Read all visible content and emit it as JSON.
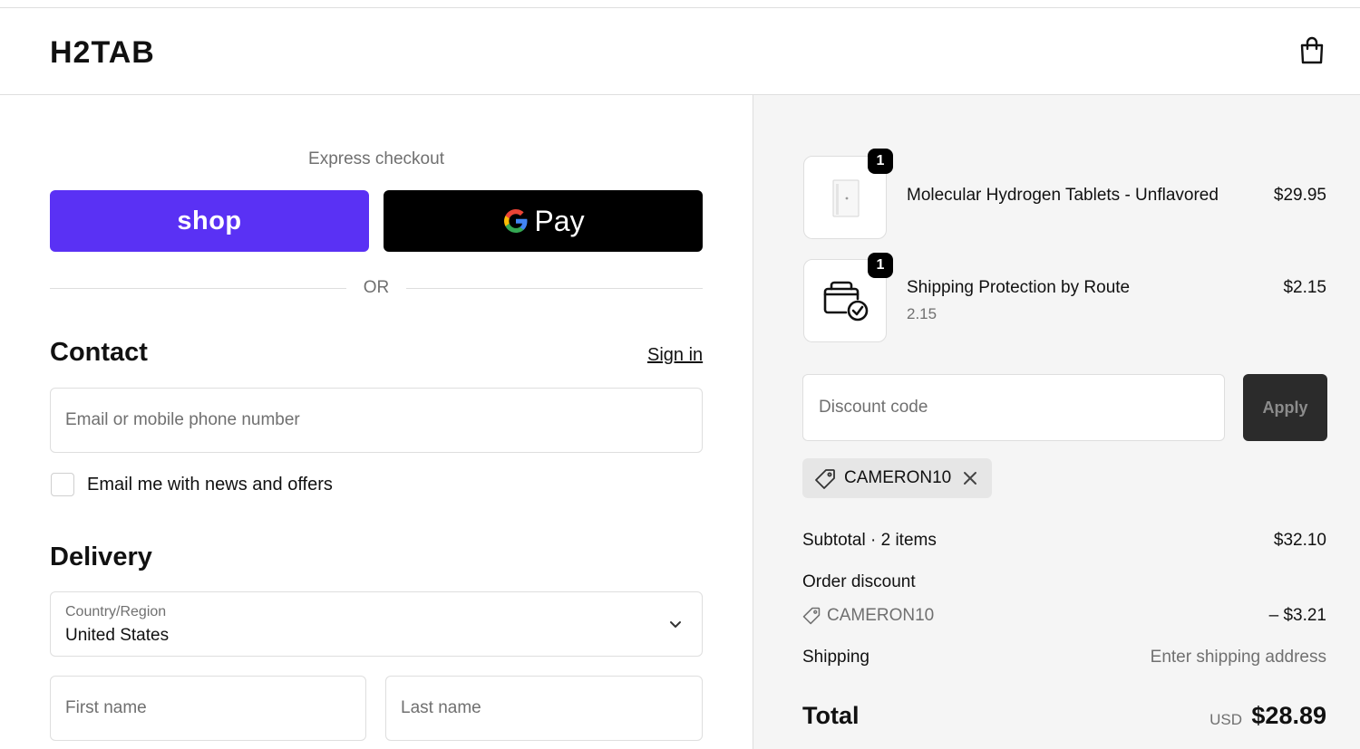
{
  "header": {
    "logo": "H2TAB",
    "cart_icon": "shopping-bag-icon"
  },
  "express": {
    "label": "Express checkout",
    "shop_label": "shop",
    "gpay_label": "Pay",
    "or_label": "OR",
    "shop_color": "#5a31f4"
  },
  "contact": {
    "title": "Contact",
    "signin_label": "Sign in",
    "email_placeholder": "Email or mobile phone number",
    "news_label": "Email me with news and offers"
  },
  "delivery": {
    "title": "Delivery",
    "country_label": "Country/Region",
    "country_value": "United States",
    "first_name_placeholder": "First name",
    "last_name_placeholder": "Last name"
  },
  "cart": {
    "items": [
      {
        "name": "Molecular Hydrogen Tablets - Unflavored",
        "price": "$29.95",
        "quantity": "1",
        "icon": "product-image"
      },
      {
        "name": "Shipping Protection by Route",
        "subtitle": "2.15",
        "price": "$2.15",
        "quantity": "1",
        "icon": "shipping-protection-icon"
      }
    ]
  },
  "discount": {
    "placeholder": "Discount code",
    "apply_label": "Apply",
    "applied_code": "CAMERON10"
  },
  "summary": {
    "subtotal_label": "Subtotal · 2 items",
    "subtotal_value": "$32.10",
    "order_discount_label": "Order discount",
    "discount_code": "CAMERON10",
    "discount_value": "– $3.21",
    "shipping_label": "Shipping",
    "shipping_value": "Enter shipping address",
    "total_label": "Total",
    "total_currency": "USD",
    "total_value": "$28.89"
  }
}
